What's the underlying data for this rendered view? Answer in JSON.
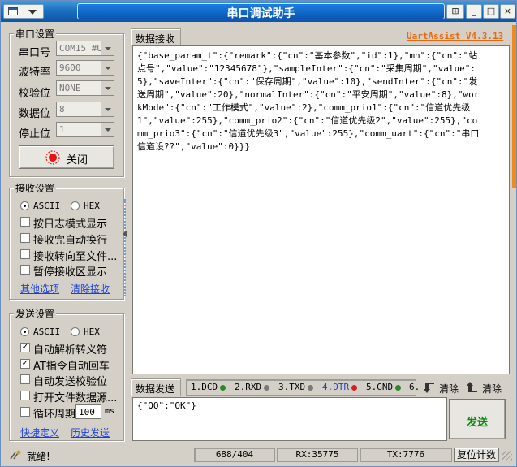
{
  "window": {
    "title": "串口调试助手",
    "pin_label": "⊞",
    "min_label": "_",
    "max_label": "□",
    "close_label": "×"
  },
  "serial_group": {
    "title": "串口设置",
    "fields": [
      {
        "label": "串口号",
        "value": "COM15 #US"
      },
      {
        "label": "波特率",
        "value": "9600"
      },
      {
        "label": "校验位",
        "value": "NONE"
      },
      {
        "label": "数据位",
        "value": "8"
      },
      {
        "label": "停止位",
        "value": "1"
      }
    ],
    "close_button": "关闭"
  },
  "recv_group": {
    "title": "接收设置",
    "ascii": "ASCII",
    "hex": "HEX",
    "options": [
      "按日志模式显示",
      "接收完自动换行",
      "接收转向至文件...",
      "暂停接收区显示"
    ],
    "more_options": "其他选项",
    "clear_recv": "清除接收"
  },
  "send_group": {
    "title": "发送设置",
    "ascii": "ASCII",
    "hex": "HEX",
    "options": [
      "自动解析转义符",
      "AT指令自动回车",
      "自动发送校验位",
      "打开文件数据源..."
    ],
    "options_checked": [
      true,
      true,
      false,
      false
    ],
    "loop_label": "循环周期",
    "loop_value": "100",
    "loop_unit": "ms",
    "shortcut": "快捷定义",
    "history": "历史发送"
  },
  "receive": {
    "tab_label": "数据接收",
    "app_version": "UartAssist V4.3.13",
    "text": "{\"base_param_t\":{\"remark\":{\"cn\":\"基本参数\",\"id\":1},\"mn\":{\"cn\":\"站点号\",\"value\":\"12345678\"},\"sampleInter\":{\"cn\":\"采集周期\",\"value\":5},\"saveInter\":{\"cn\":\"保存周期\",\"value\":10},\"sendInter\":{\"cn\":\"发送周期\",\"value\":20},\"normalInter\":{\"cn\":\"平安周期\",\"value\":8},\"workMode\":{\"cn\":\"工作模式\",\"value\":2},\"comm_prio1\":{\"cn\":\"信道优先级1\",\"value\":255},\"comm_prio2\":{\"cn\":\"信道优先级2\",\"value\":255},\"comm_prio3\":{\"cn\":\"信道优先级3\",\"value\":255},\"comm_uart\":{\"cn\":\"串口信道设??\",\"value\":0}}}"
  },
  "send": {
    "tab_label": "数据发送",
    "signals": [
      {
        "label": "1.DCD",
        "color": "#2a8a2a"
      },
      {
        "label": "2.RXD",
        "color": "#7a7a7a"
      },
      {
        "label": "3.TXD",
        "color": "#7a7a7a"
      },
      {
        "label": "4.DTR",
        "color": "#d42020"
      },
      {
        "label": "5.GND",
        "color": "#2a8a2a"
      },
      {
        "label": "6.",
        "color": ""
      }
    ],
    "clear1": "清除",
    "clear2": "清除",
    "text": "{\"QO\":\"OK\"}",
    "send_button": "发送"
  },
  "statusbar": {
    "ready": "就绪!",
    "progress": "688/404",
    "rx": "RX:35775",
    "tx": "TX:7776",
    "reset": "复位计数"
  },
  "colors": {
    "title_blue": "#1c6fc1",
    "version_orange": "#e86a10",
    "link_blue": "#1c3fd6",
    "send_green": "#118811"
  }
}
